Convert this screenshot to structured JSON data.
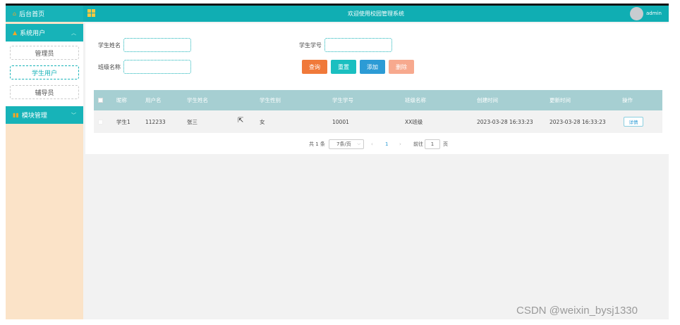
{
  "sidebar": {
    "home": {
      "icon": "home-icon",
      "label": "后台首页"
    },
    "groups": [
      {
        "icon": "user-icon",
        "label": "系统用户",
        "chevron": "chevron-up-icon",
        "items": [
          {
            "label": "管理员",
            "active": false
          },
          {
            "label": "学生用户",
            "active": true
          },
          {
            "label": "辅导员",
            "active": false
          }
        ]
      },
      {
        "icon": "module-icon",
        "label": "模块管理",
        "chevron": "chevron-down-icon",
        "items": []
      }
    ]
  },
  "header": {
    "menu_icon": "grid-icon",
    "title": "欢迎使用校园管理系统",
    "username": "admin"
  },
  "search": {
    "name_label": "学生姓名",
    "name_value": "",
    "id_label": "学生学号",
    "id_value": "",
    "class_label": "班级名称",
    "class_value": ""
  },
  "buttons": {
    "query": "查询",
    "reset": "重置",
    "add": "添加",
    "delete": "删除"
  },
  "table": {
    "columns": [
      "昵称",
      "用户名",
      "学生姓名",
      "学生性别",
      "学生学号",
      "班级名称",
      "创建时间",
      "更新时间",
      "操作"
    ],
    "rows": [
      {
        "nickname": "学生1",
        "username": "112233",
        "name": "张三",
        "gender": "女",
        "student_id": "10001",
        "class_name": "XX班级",
        "created": "2023-03-28 16:33:23",
        "updated": "2023-03-28 16:33:23",
        "action": "详情"
      }
    ]
  },
  "pagination": {
    "total": "共 1 条",
    "page_size": "7条/页",
    "current_page": "1",
    "goto_label": "前往",
    "goto_value": "1",
    "page_suffix": "页"
  },
  "colors": {
    "primary": "#10aeb3",
    "sidebar_bg": "#fbe3c8",
    "table_header": "#a6cfd2",
    "query": "#f0793a",
    "reset": "#1abfc0",
    "add": "#2c9bd5",
    "delete": "#f7a98e"
  },
  "watermark": "CSDN @weixin_bysj1330"
}
